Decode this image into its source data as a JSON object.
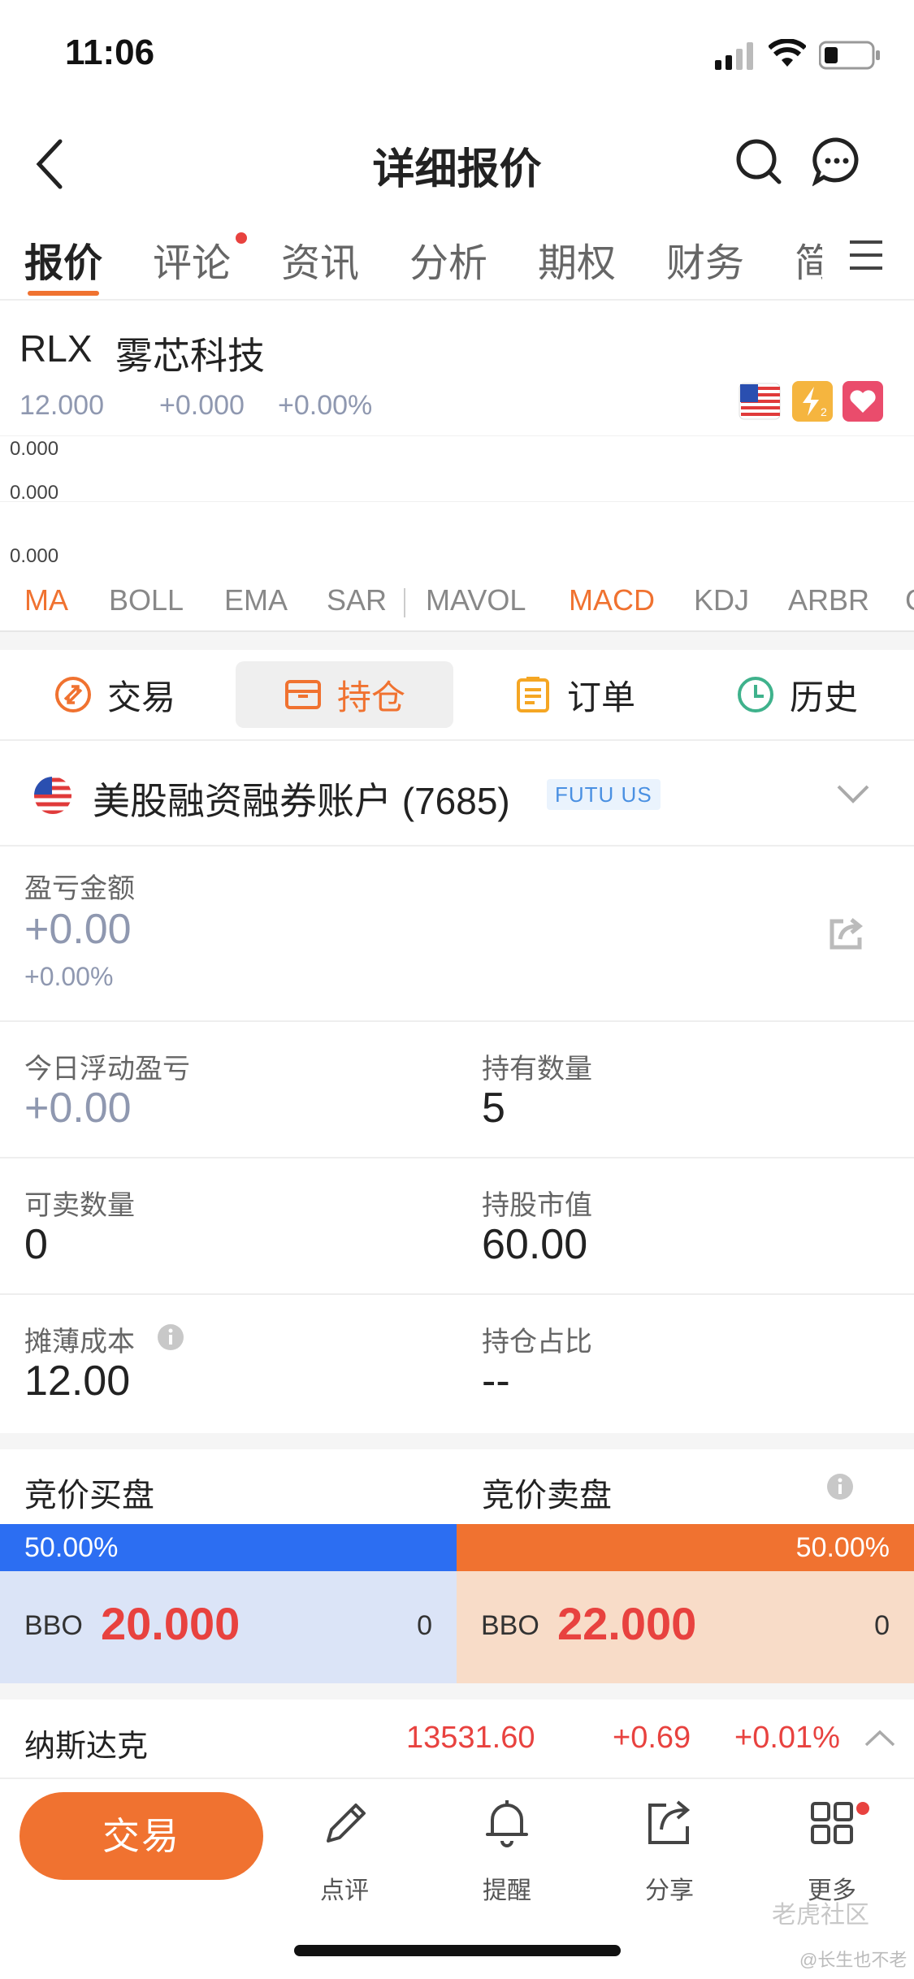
{
  "status_bar": {
    "time": "11:06"
  },
  "nav": {
    "title": "详细报价",
    "icons": [
      "back-icon",
      "search-icon",
      "chat-icon"
    ]
  },
  "tabs": [
    "报价",
    "评论",
    "资讯",
    "分析",
    "期权",
    "财务",
    "简"
  ],
  "tabs_active": "报价",
  "quote": {
    "code": "RLX",
    "name": "雾芯科技",
    "price": "12.000",
    "change": "+0.000",
    "change_pct": "+0.00%"
  },
  "chart_labels": [
    "0.000",
    "0.000",
    "0.000"
  ],
  "indicators": [
    "MA",
    "BOLL",
    "EMA",
    "SAR",
    "MAVOL",
    "MACD",
    "KDJ",
    "ARBR",
    "C"
  ],
  "indicators_active": [
    "MA",
    "MACD"
  ],
  "subtabs": [
    "交易",
    "持仓",
    "订单",
    "历史"
  ],
  "subtabs_active": "持仓",
  "account": {
    "name": "美股融资融券账户 (7685)",
    "tag": "FUTU US"
  },
  "position": {
    "pl_label": "盈亏金额",
    "pl_value": "+0.00",
    "pl_pct": "+0.00%",
    "today_label": "今日浮动盈亏",
    "today_value": "+0.00",
    "qty_label": "持有数量",
    "qty_value": "5",
    "sellable_label": "可卖数量",
    "sellable_value": "0",
    "mktval_label": "持股市值",
    "mktval_value": "60.00",
    "cost_label": "摊薄成本",
    "cost_value": "12.00",
    "ratio_label": "持仓占比",
    "ratio_value": "--"
  },
  "auction": {
    "buy_label": "竞价买盘",
    "sell_label": "竞价卖盘",
    "buy_pct": "50.00%",
    "sell_pct": "50.00%",
    "buy_bbo": "BBO",
    "buy_price": "20.000",
    "buy_qty": "0",
    "sell_bbo": "BBO",
    "sell_price": "22.000",
    "sell_qty": "0"
  },
  "index": {
    "name": "纳斯达克",
    "value": "13531.60",
    "change": "+0.69",
    "change_pct": "+0.01%"
  },
  "bottom": {
    "trade": "交易",
    "comment": "点评",
    "alert": "提醒",
    "share": "分享",
    "more": "更多"
  },
  "watermark": {
    "line1": "老虎社区",
    "line2": "@长生也不老"
  },
  "colors": {
    "accent": "#f07230",
    "up": "#e8423f",
    "buy_bar": "#2c6ef2",
    "neutral": "#8f98b0"
  }
}
